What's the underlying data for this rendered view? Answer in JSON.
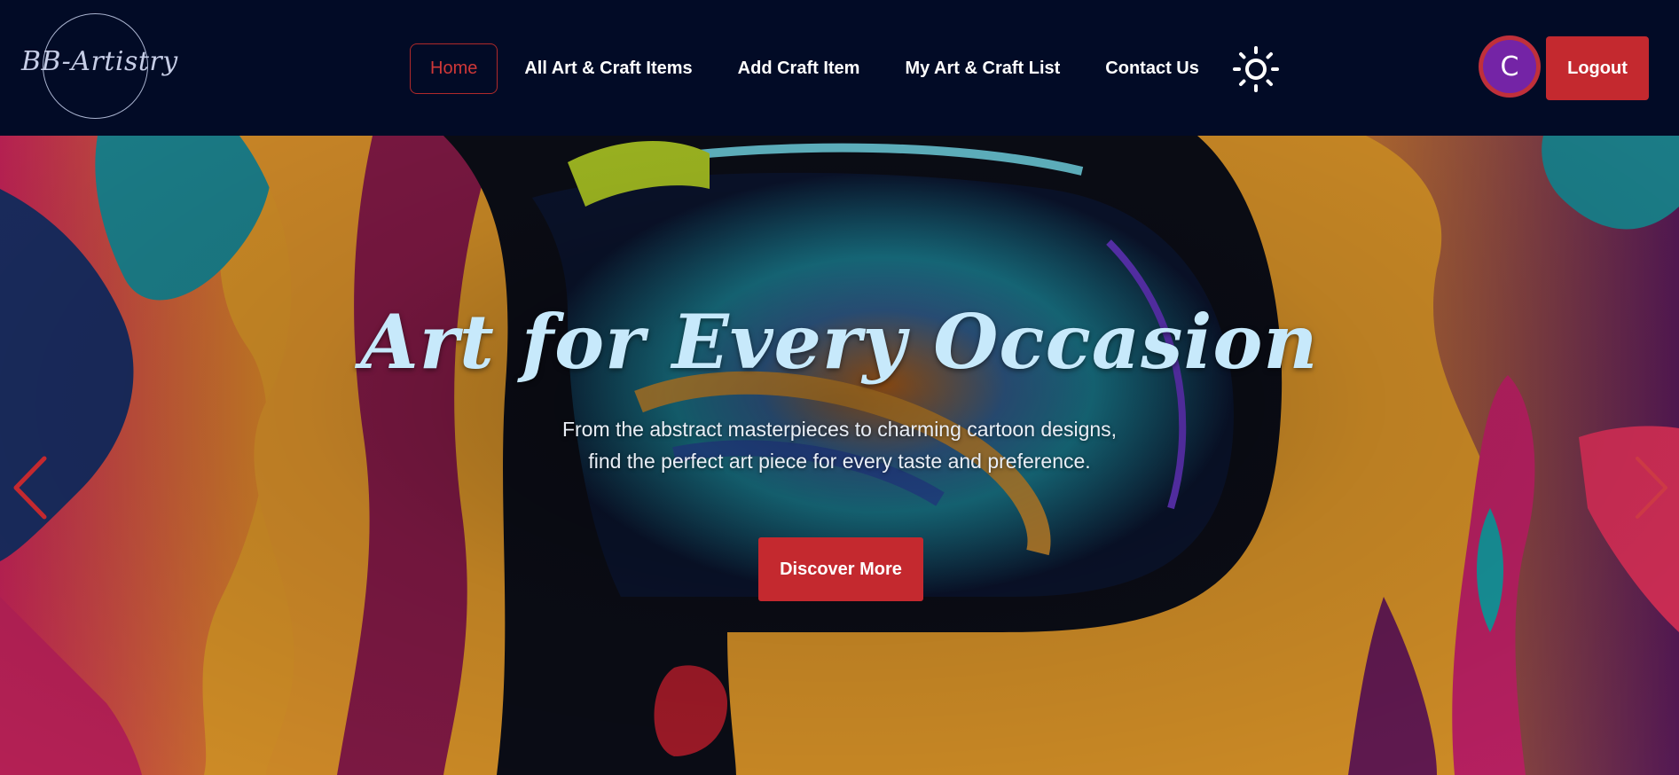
{
  "brand": {
    "logo_text": "BB-Artistry"
  },
  "nav": {
    "links": [
      {
        "label": "Home",
        "active": true
      },
      {
        "label": "All Art & Craft Items"
      },
      {
        "label": "Add Craft Item"
      },
      {
        "label": "My Art & Craft List"
      },
      {
        "label": "Contact Us"
      }
    ],
    "theme_toggle_icon": "sun-icon",
    "avatar_initial": "C",
    "logout_label": "Logout"
  },
  "hero": {
    "title": "Art for Every Occasion",
    "subtitle_line1": "From the abstract masterpieces to charming cartoon designs,",
    "subtitle_line2": "find the perfect art piece for every taste and preference.",
    "cta_label": "Discover More",
    "prev_icon": "chevron-left-icon",
    "next_icon": "chevron-right-icon"
  },
  "colors": {
    "nav_bg": "#020b26",
    "accent_red": "#c4292f",
    "avatar_purple": "#7424a6",
    "hero_title": "#c7e9fb"
  }
}
